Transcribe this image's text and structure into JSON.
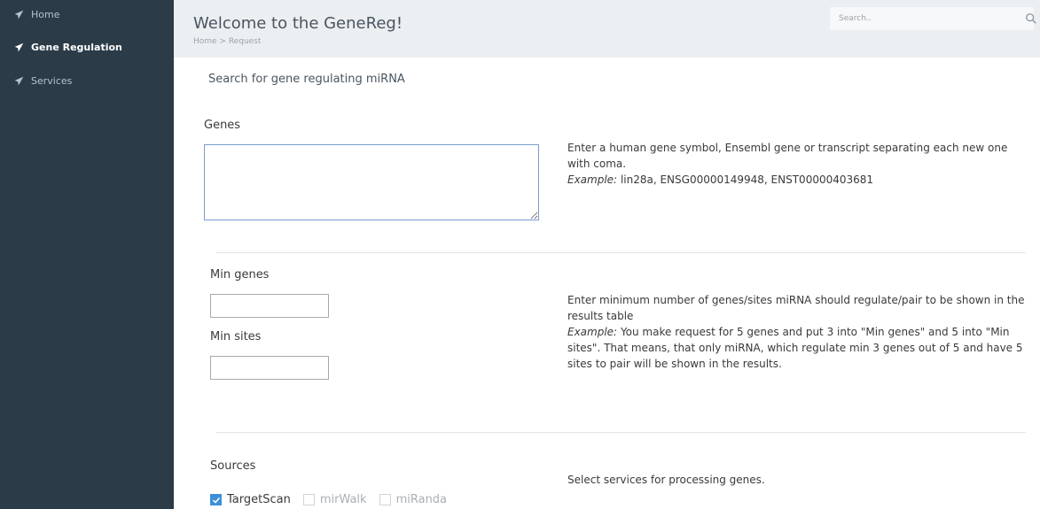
{
  "sidebar": {
    "items": [
      {
        "label": "Home",
        "icon": "plane-icon",
        "active": false
      },
      {
        "label": "Gene Regulation",
        "icon": "plane-icon",
        "active": true
      },
      {
        "label": "Services",
        "icon": "plane-icon",
        "active": false
      }
    ]
  },
  "header": {
    "title": "Welcome to the GeneReg!",
    "breadcrumb": "Home > Request",
    "search_placeholder": "Search.."
  },
  "form": {
    "title": "Search for gene regulating miRNA",
    "genes": {
      "label": "Genes",
      "value": "",
      "hint": "Enter a human gene symbol, Ensembl gene or transcript separating each new one with coma.",
      "example_label": "Example:",
      "example_text": "lin28a, ENSG00000149948, ENST00000403681"
    },
    "min_genes": {
      "label": "Min genes",
      "value": ""
    },
    "min_sites": {
      "label": "Min sites",
      "value": ""
    },
    "min_hint": {
      "text": "Enter minimum number of genes/sites miRNA should regulate/pair to be shown in the results table",
      "example_label": "Example:",
      "example_text": "You make request for 5 genes and put 3 into \"Min genes\" and 5 into \"Min sites\". That means, that only miRNA, which regulate min 3 genes out of 5 and have 5 sites to pair will be shown in the results."
    },
    "sources": {
      "label": "Sources",
      "hint": "Select services for processing genes.",
      "options": [
        {
          "label": "TargetScan",
          "checked": true
        },
        {
          "label": "mirWalk",
          "checked": false
        },
        {
          "label": "miRanda",
          "checked": false
        }
      ]
    }
  },
  "colors": {
    "sidebar_bg": "#2b3b48",
    "header_bg": "#eceff1",
    "checkbox_accent": "#3d8fd8"
  }
}
